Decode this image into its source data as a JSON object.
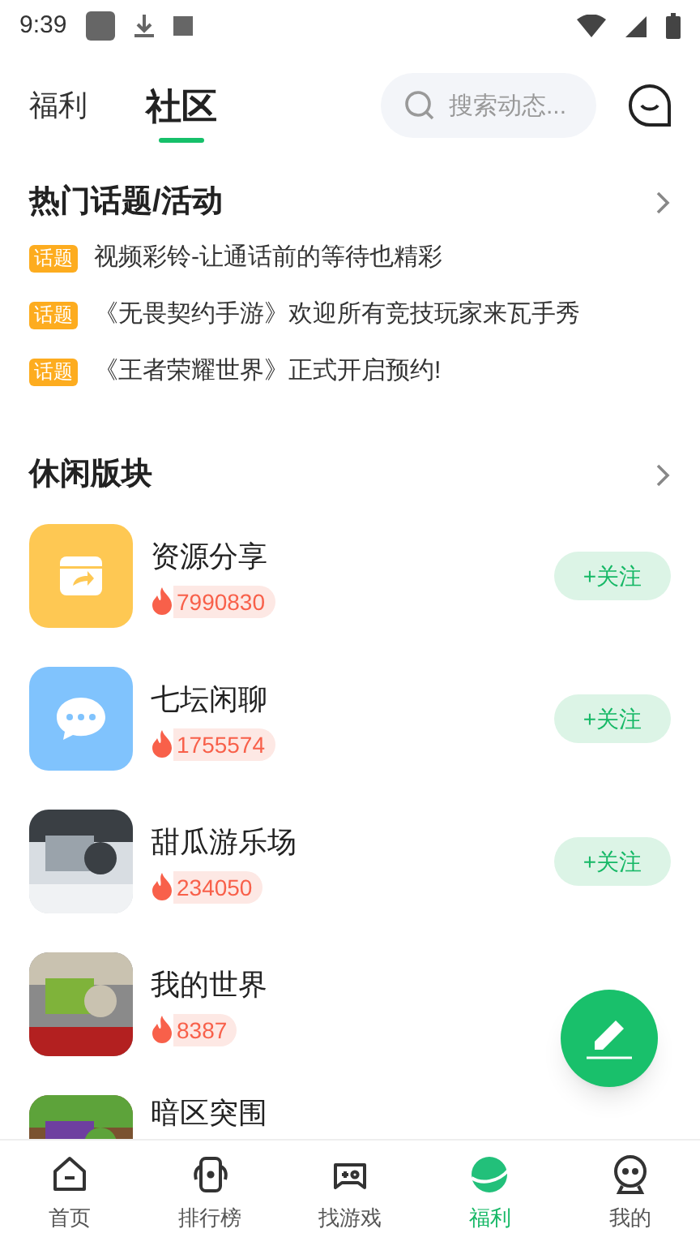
{
  "status_bar": {
    "time": "9:39"
  },
  "header": {
    "tabs": [
      {
        "label": "福利",
        "selected": false
      },
      {
        "label": "社区",
        "selected": true
      }
    ],
    "search": {
      "placeholder": "搜索动态..."
    }
  },
  "hot_topics": {
    "title": "热门话题/活动",
    "items": [
      {
        "tag": "话题",
        "text": "视频彩铃-让通话前的等待也精彩"
      },
      {
        "tag": "话题",
        "text": "《无畏契约手游》欢迎所有竞技玩家来瓦手秀"
      },
      {
        "tag": "话题",
        "text": "《王者荣耀世界》正式开启预约!"
      }
    ]
  },
  "boards": {
    "title": "休闲版块",
    "items": [
      {
        "kind": "share",
        "name": "资源分享",
        "count": "7990830",
        "button": "+关注"
      },
      {
        "kind": "chat",
        "name": "七坛闲聊",
        "count": "1755574",
        "button": "+关注"
      },
      {
        "kind": "picture",
        "name": "甜瓜游乐场",
        "count": "234050",
        "button": "+关注"
      },
      {
        "kind": "picture",
        "name": "我的世界",
        "count": "8387"
      },
      {
        "kind": "picture",
        "name": "暗区突围"
      }
    ]
  },
  "bottom_nav": [
    {
      "label": "首页",
      "selected": false
    },
    {
      "label": "排行榜",
      "selected": false
    },
    {
      "label": "找游戏",
      "selected": false
    },
    {
      "label": "福利",
      "selected": true
    },
    {
      "label": "我的",
      "selected": false
    }
  ]
}
